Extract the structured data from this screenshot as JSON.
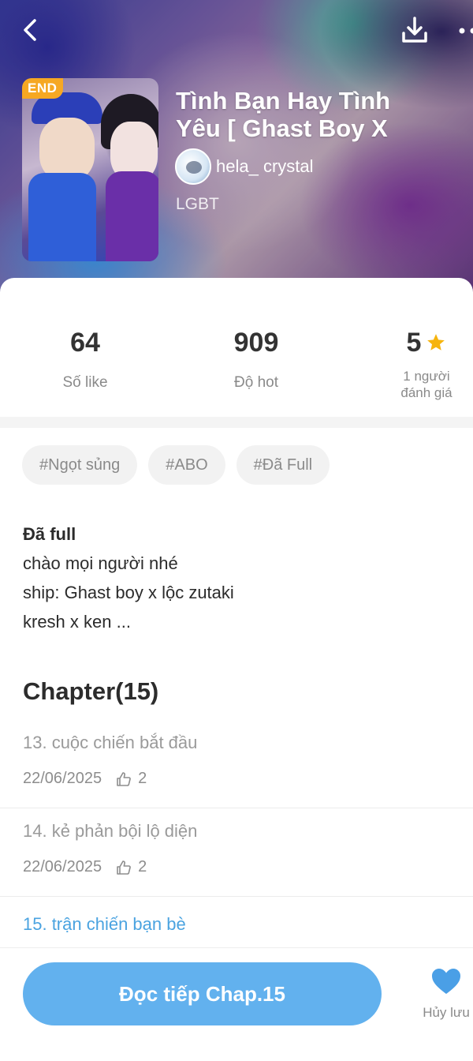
{
  "colors": {
    "accent": "#62b1ee",
    "current_chapter": "#4aa3e0",
    "end_badge": "#f6a823",
    "star": "#f6b40e",
    "heart": "#4a9fe6"
  },
  "header": {
    "back_icon": "back-arrow-icon",
    "download_icon": "download-icon",
    "more_icon": "more-dots-icon"
  },
  "story": {
    "end_badge": "END",
    "title": "Tình Bạn Hay Tình Yêu [ Ghast Boy X Lộc",
    "author": "hela_ crystal",
    "genre": "LGBT"
  },
  "stats": {
    "likes": {
      "value": "64",
      "label": "Số like"
    },
    "hot": {
      "value": "909",
      "label": "Độ hot"
    },
    "rating": {
      "value": "5",
      "label_line1": "1 người",
      "label_line2": "đánh giá"
    }
  },
  "tags": [
    "#Ngọt sủng",
    "#ABO",
    "#Đã Full"
  ],
  "description": {
    "status": "Đã full",
    "lines": [
      "chào mọi người nhé",
      "ship: Ghast boy x lộc zutaki",
      "kresh x ken ..."
    ]
  },
  "chapters": {
    "heading": "Chapter(15)",
    "items": [
      {
        "title": "13. cuộc chiến bắt đầu",
        "date": "22/06/2025",
        "likes": "2"
      },
      {
        "title": "14. kẻ phản bội lộ diện",
        "date": "22/06/2025",
        "likes": "2"
      },
      {
        "title": "15. trận chiến bạn bè"
      }
    ]
  },
  "bottom": {
    "read_button": "Đọc tiếp Chap.15",
    "save_label": "Hủy lưu"
  }
}
